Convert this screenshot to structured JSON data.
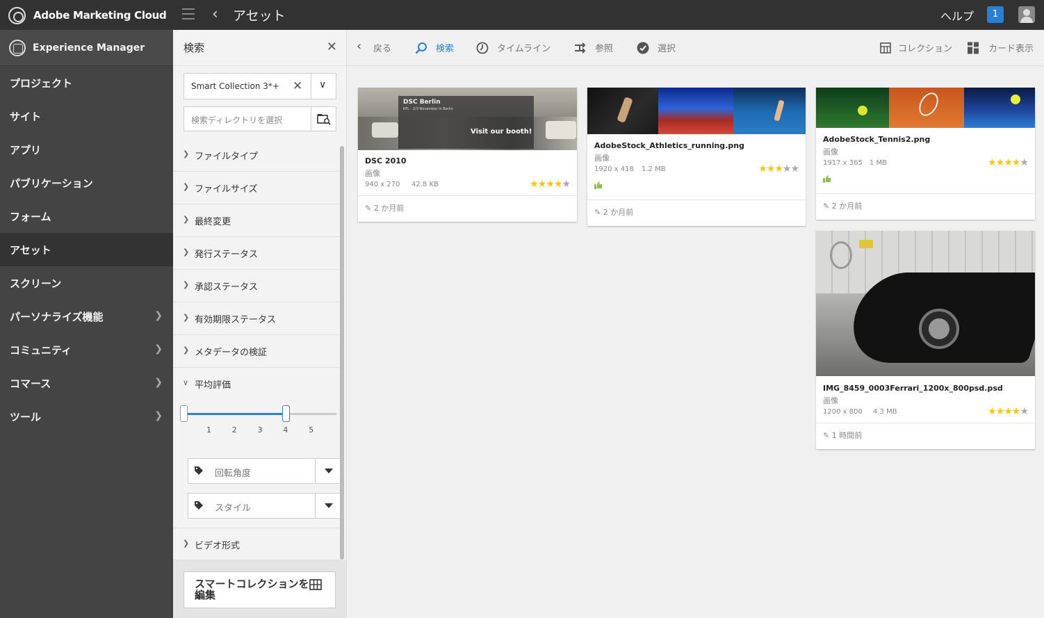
{
  "topbar": {
    "brand": "Adobe Marketing Cloud",
    "title": "アセット",
    "help": "ヘルプ",
    "notifications": "1"
  },
  "leftnav": {
    "header": "Experience Manager",
    "items": [
      {
        "label": "プロジェクト",
        "chevron": false,
        "active": false
      },
      {
        "label": "サイト",
        "chevron": false,
        "active": false
      },
      {
        "label": "アプリ",
        "chevron": false,
        "active": false
      },
      {
        "label": "パブリケーション",
        "chevron": false,
        "active": false
      },
      {
        "label": "フォーム",
        "chevron": false,
        "active": false
      },
      {
        "label": "アセット",
        "chevron": false,
        "active": true
      },
      {
        "label": "スクリーン",
        "chevron": false,
        "active": false
      },
      {
        "label": "パーソナライズ機能",
        "chevron": true,
        "active": false
      },
      {
        "label": "コミュニティ",
        "chevron": true,
        "active": false
      },
      {
        "label": "コマース",
        "chevron": true,
        "active": false
      },
      {
        "label": "ツール",
        "chevron": true,
        "active": false
      }
    ]
  },
  "rail": {
    "title": "検索",
    "collection_value": "Smart Collection 3*+",
    "directory_placeholder": "検索ディレクトリを選択",
    "facets": [
      "ファイルタイプ",
      "ファイルサイズ",
      "最終変更",
      "発行ステータス",
      "承認ステータス",
      "有効期限ステータス",
      "メタデータの検証"
    ],
    "rating": {
      "label": "平均評価",
      "ticks": [
        "1",
        "2",
        "3",
        "4",
        "5"
      ],
      "range_min": 0,
      "range_max": 4
    },
    "rotation_placeholder": "回転角度",
    "style_placeholder": "スタイル",
    "video_format": "ビデオ形式",
    "edit_button": "スマートコレクションを編集"
  },
  "toolbar": {
    "back": "戻る",
    "search": "検索",
    "timeline": "タイムライン",
    "references": "参照",
    "select": "選択",
    "collection": "コレクション",
    "card_view": "カード表示"
  },
  "cards": [
    {
      "title": "DSC 2010",
      "type": "画像",
      "dims": "940 x 270",
      "size": "42.8 KB",
      "rating": 4,
      "modified": "2 か月前",
      "thumb_text_1": "DSC Berlin",
      "thumb_text_2": "KFL - 2/3 November in Berlin",
      "thumb_text_3": "Visit our booth!"
    },
    {
      "title": "AdobeStock_Athletics_running.png",
      "type": "画像",
      "dims": "1920 x 418",
      "size": "1.2 MB",
      "rating": 3,
      "modified": "2 か月前"
    },
    {
      "title": "AdobeStock_Tennis2.png",
      "type": "画像",
      "dims": "1917 x 365",
      "size": "1 MB",
      "rating": 4,
      "modified": "2 か月前"
    },
    {
      "title": "IMG_8459_0003Ferrari_1200x_800psd.psd",
      "type": "画像",
      "dims": "1200 x 800",
      "size": "4.3 MB",
      "rating": 4,
      "modified": "1 時間前"
    }
  ],
  "colors": {
    "topbar": "#323232",
    "nav": "#444444",
    "accent": "#2a7fd4",
    "star": "#f5c518",
    "thumbup": "#8cc152"
  }
}
